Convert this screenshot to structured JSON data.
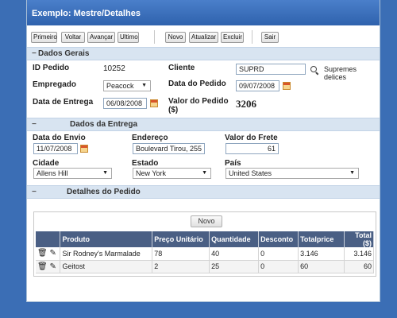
{
  "window": {
    "title": "Exemplo: Mestre/Detalhes"
  },
  "toolbar": {
    "first": "Primeiro",
    "prev": "Voltar",
    "next": "Avançar",
    "last": "Ultimo",
    "new": "Novo",
    "update": "Atualizar",
    "delete": "Excluir",
    "exit": "Sair"
  },
  "general": {
    "section": "Dados Gerais",
    "order_id_label": "ID Pedido",
    "order_id": "10252",
    "client_label": "Cliente",
    "client_code": "SUPRD",
    "client_name": "Supremes delices",
    "employee_label": "Empregado",
    "employee": "Peacock",
    "order_date_label": "Data do Pedido",
    "order_date": "09/07/2008",
    "delivery_date_label": "Data de Entrega",
    "delivery_date": "06/08/2008",
    "order_value_label": "Valor do Pedido",
    "order_value_unit": "($)",
    "order_value": "3206"
  },
  "delivery": {
    "section": "Dados da Entrega",
    "ship_date_label": "Data do Envio",
    "ship_date": "11/07/2008",
    "address_label": "Endereço",
    "address": "Boulevard Tirou, 255",
    "freight_label": "Valor do Frete",
    "freight": "61",
    "city_label": "Cidade",
    "city": "Allens Hill",
    "state_label": "Estado",
    "state": "New York",
    "country_label": "País",
    "country": "United States"
  },
  "details": {
    "section": "Detalhes do Pedido",
    "new_button": "Novo",
    "columns": [
      "Produto",
      "Preço Unitário",
      "Quantidade",
      "Desconto",
      "Totalprice",
      "Total ($)"
    ],
    "rows": [
      {
        "produto": "Sir Rodney's Marmalade",
        "preco": "78",
        "quantidade": "40",
        "desconto": "0",
        "totalprice": "3.146",
        "total": "3.146"
      },
      {
        "produto": "Geitost",
        "preco": "2",
        "quantidade": "25",
        "desconto": "0",
        "totalprice": "60",
        "total": "60"
      }
    ]
  },
  "colors": {
    "background": "#3b6eb5",
    "titlebar": "#2f62ad",
    "section": "#d8e4f1",
    "grid_header": "#4a5f84"
  }
}
